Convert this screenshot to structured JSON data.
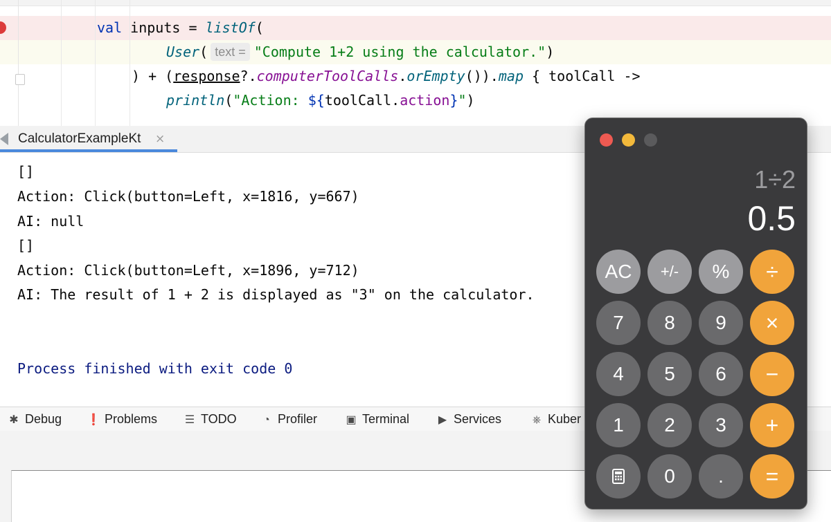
{
  "editor": {
    "line1": {
      "kw": "val",
      "name": " inputs = ",
      "fn": "listOf",
      "paren": "("
    },
    "line2": {
      "cls": "User",
      "paren": "(",
      "hint": "text =",
      "str": "\"Compute 1+2 using the calculator.\"",
      "close": ")"
    },
    "line3": {
      "pre": ") + (",
      "recv": "response",
      "op": "?.",
      "prop": "computerToolCalls",
      "dot": ".",
      "fn1": "orEmpty",
      "mid": "()).",
      "fn2": "map",
      "post": " { toolCall ->"
    },
    "line4": {
      "fn": "println",
      "open": "(",
      "str1": "\"Action: ",
      "tmpl_open": "${",
      "var": "toolCall",
      "dot": ".",
      "prop": "action",
      "tmpl_close": "}",
      "str2": "\"",
      "close": ")"
    }
  },
  "run_window": {
    "tab_label": "CalculatorExampleKt",
    "close_glyph": "×"
  },
  "console": {
    "lines": [
      "[]",
      "Action: Click(button=Left, x=1816, y=667)",
      "AI: null",
      "[]",
      "Action: Click(button=Left, x=1896, y=712)",
      "AI: The result of 1 + 2 is displayed as \"3\" on the calculator."
    ],
    "exit_message": "Process finished with exit code 0"
  },
  "toolstrip": {
    "items": [
      {
        "label": "Debug",
        "icon": "bug-icon"
      },
      {
        "label": "Problems",
        "icon": "problems-icon"
      },
      {
        "label": "TODO",
        "icon": "list-icon"
      },
      {
        "label": "Profiler",
        "icon": "profiler-icon"
      },
      {
        "label": "Terminal",
        "icon": "terminal-icon"
      },
      {
        "label": "Services",
        "icon": "services-icon"
      },
      {
        "label": "Kuber",
        "icon": "kubernetes-icon"
      }
    ]
  },
  "calculator": {
    "expression": "1÷2",
    "result": "0.5",
    "keys": [
      {
        "label": "AC",
        "kind": "function"
      },
      {
        "label": "+/-",
        "kind": "function"
      },
      {
        "label": "%",
        "kind": "function"
      },
      {
        "label": "÷",
        "kind": "operator"
      },
      {
        "label": "7",
        "kind": "number"
      },
      {
        "label": "8",
        "kind": "number"
      },
      {
        "label": "9",
        "kind": "number"
      },
      {
        "label": "×",
        "kind": "operator"
      },
      {
        "label": "4",
        "kind": "number"
      },
      {
        "label": "5",
        "kind": "number"
      },
      {
        "label": "6",
        "kind": "number"
      },
      {
        "label": "−",
        "kind": "operator"
      },
      {
        "label": "1",
        "kind": "number"
      },
      {
        "label": "2",
        "kind": "number"
      },
      {
        "label": "3",
        "kind": "number"
      },
      {
        "label": "+",
        "kind": "operator"
      },
      {
        "label": "calculator-icon",
        "kind": "number"
      },
      {
        "label": "0",
        "kind": "number"
      },
      {
        "label": ".",
        "kind": "number"
      },
      {
        "label": "=",
        "kind": "operator"
      }
    ],
    "colors": {
      "operator": "#f1a43b",
      "function": "#9c9c9f",
      "number": "#6a6a6c",
      "body": "#3a3a3c"
    }
  }
}
